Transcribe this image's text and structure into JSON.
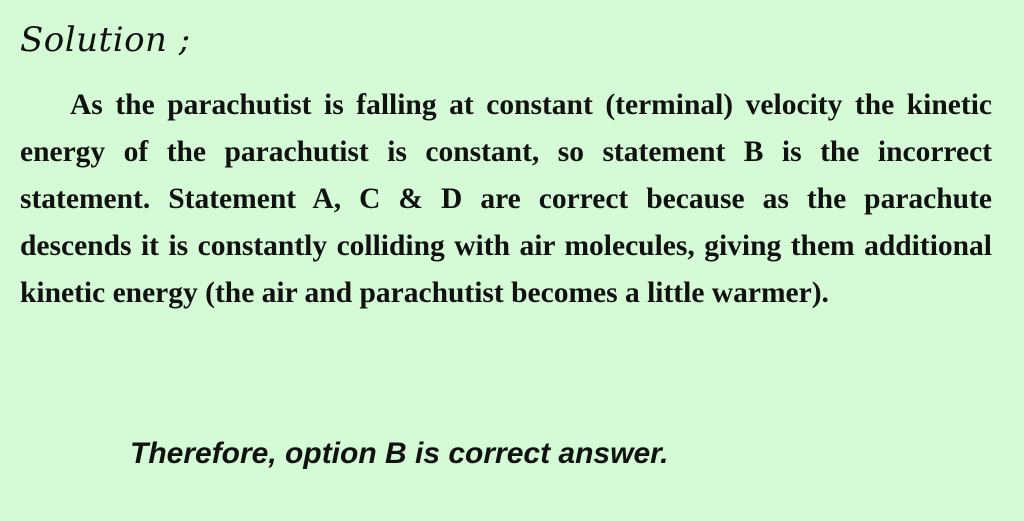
{
  "solution": {
    "heading": "Solution ;",
    "paragraph": "As the parachutist is falling at constant (terminal) velocity the kinetic energy of the parachutist is constant, so statement B is the incorrect statement. Statement A, C & D are correct because as the parachute descends it is constantly colliding with air molecules, giving them additional kinetic energy (the air and parachutist becomes a little warmer).",
    "conclusion": "Therefore, option B is correct answer."
  }
}
